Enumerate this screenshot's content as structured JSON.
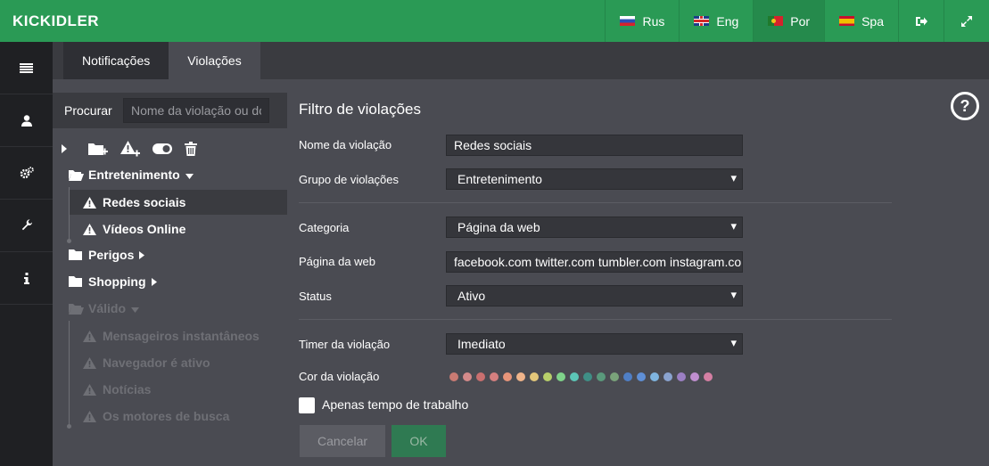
{
  "app": {
    "logo_text": "KICKIDLER"
  },
  "languages": [
    {
      "label": "Rus",
      "flag": "flag-ru"
    },
    {
      "label": "Eng",
      "flag": "flag-en"
    },
    {
      "label": "Por",
      "flag": "flag-pt"
    },
    {
      "label": "Spa",
      "flag": "flag-es"
    }
  ],
  "topbar_icons": [
    "logout-icon",
    "fullscreen-icon"
  ],
  "sidebar_icons": [
    "list-icon",
    "user-icon",
    "settings-icon",
    "wrench-icon",
    "info-icon"
  ],
  "tabs": [
    {
      "label": "Notificações",
      "active": false
    },
    {
      "label": "Violações",
      "active": true
    }
  ],
  "tree": {
    "search_label": "Procurar",
    "search_placeholder": "Nome da violação ou do grupo",
    "nodes": [
      {
        "label": "Entretenimento",
        "type": "group",
        "state": "expanded"
      },
      {
        "label": "Redes sociais",
        "type": "violation",
        "selected": true
      },
      {
        "label": "Vídeos Online",
        "type": "violation"
      },
      {
        "label": "Perigos",
        "type": "group",
        "state": "collapsed"
      },
      {
        "label": "Shopping",
        "type": "group",
        "state": "collapsed"
      },
      {
        "label": "Válido",
        "type": "group",
        "state": "expanded",
        "disabled": true
      },
      {
        "label": "Mensageiros instantâneos",
        "type": "violation",
        "disabled": true
      },
      {
        "label": "Navegador é ativo",
        "type": "violation",
        "disabled": true
      },
      {
        "label": "Notícias",
        "type": "violation",
        "disabled": true
      },
      {
        "label": "Os motores de busca",
        "type": "violation",
        "disabled": true
      }
    ]
  },
  "form": {
    "title": "Filtro de violações",
    "help": "?",
    "violation_name_label": "Nome da violação",
    "violation_name_value": "Redes sociais",
    "group_label": "Grupo de violações",
    "group_value": "Entretenimento",
    "category_label": "Categoria",
    "category_value": "Página da web",
    "webpage_label": "Página da web",
    "webpage_value": "facebook.com twitter.com tumbler.com instagram.com",
    "status_label": "Status",
    "status_value": "Ativo",
    "timer_label": "Timer da violação",
    "timer_value": "Imediato",
    "color_label": "Cor da violação",
    "colors": [
      "#c97b73",
      "#d48a8a",
      "#c96f6f",
      "#d47f7f",
      "#e8957a",
      "#f0b48a",
      "#e3c77a",
      "#b8cf6a",
      "#7fd38a",
      "#5cc6b7",
      "#3f8f86",
      "#5a9a7c",
      "#7aa37a",
      "#4f7fc6",
      "#5f8fd6",
      "#7fb5e0",
      "#8aa3cf",
      "#9b7fc3",
      "#c08fd0",
      "#d47fa3"
    ],
    "work_time_label": "Apenas tempo de trabalho",
    "cancel_label": "Cancelar",
    "ok_label": "OK"
  }
}
